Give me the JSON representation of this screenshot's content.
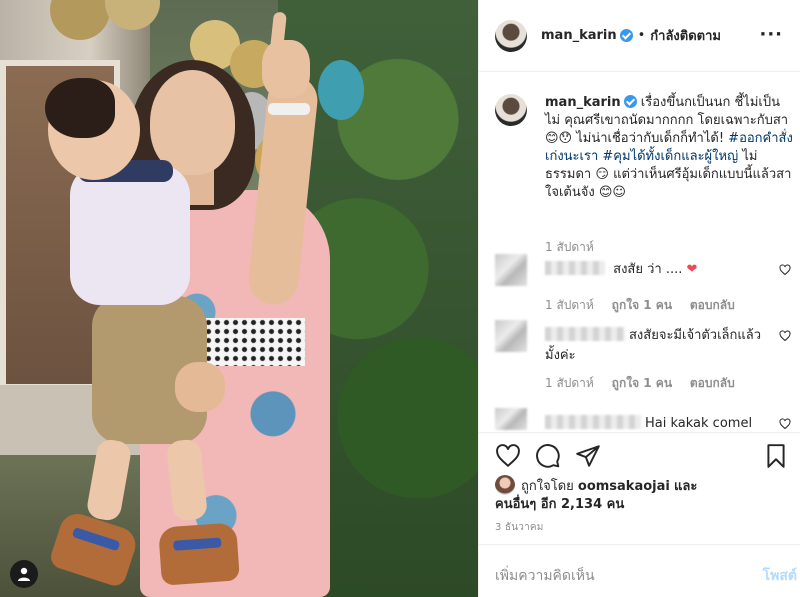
{
  "post": {
    "username": "man_karin",
    "follow_status": "กำลังติดตาม",
    "more": "···"
  },
  "caption": {
    "username": "man_karin",
    "text_1": "เรื่องขึ้นกเป็นนก ชี้ไม่เป็น ไม่ คุณศรีเขาถนัดมากกกก โดยเฉพาะกับสา",
    "emoji_1": "😊😯",
    "text_2": "ไม่น่าเชื่อว่ากับเด็กก็ทำได้!",
    "hashtag_1": "#ออกคำสั่งเก่งนะเรา",
    "hashtag_2": "#คุมได้ทั้งเด็กและผู้ใหญ่",
    "text_3": "ไม่ธรรมดา",
    "emoji_2": "😏",
    "text_4": "แต่ว่าเห็นศรีอุ้มเด็กแบบนี้แล้วสาใจเต้นจัง",
    "emoji_3": "😊☺",
    "time": "1 สัปดาห์"
  },
  "comments": [
    {
      "text": "สงสัย ว่า ....",
      "heart": "❤",
      "time": "1 สัปดาห์",
      "likes": "ถูกใจ 1 คน",
      "reply": "ตอบกลับ"
    },
    {
      "text": "สงสัยจะมีเจ้าตัวเล็กแล้วมั้งค่ะ",
      "time": "1 สัปดาห์",
      "likes": "ถูกใจ 1 คน",
      "reply": "ตอบกลับ"
    },
    {
      "text": "Hai kakak comel"
    }
  ],
  "likes": {
    "prefix": "ถูกใจโดย",
    "user": "oomsakaojai",
    "and": "และ",
    "others": "คนอื่นๆ อีก 2,134 คน"
  },
  "date": "3 ธันวาคม",
  "add_comment": {
    "placeholder": "เพิ่มความคิดเห็น",
    "post_label": "โพสต์"
  },
  "colors": {
    "link": "#00376b",
    "verified": "#3897f0",
    "heart": "#ed4956",
    "muted": "#8e8e8e",
    "post_disabled": "#b3dbff"
  }
}
